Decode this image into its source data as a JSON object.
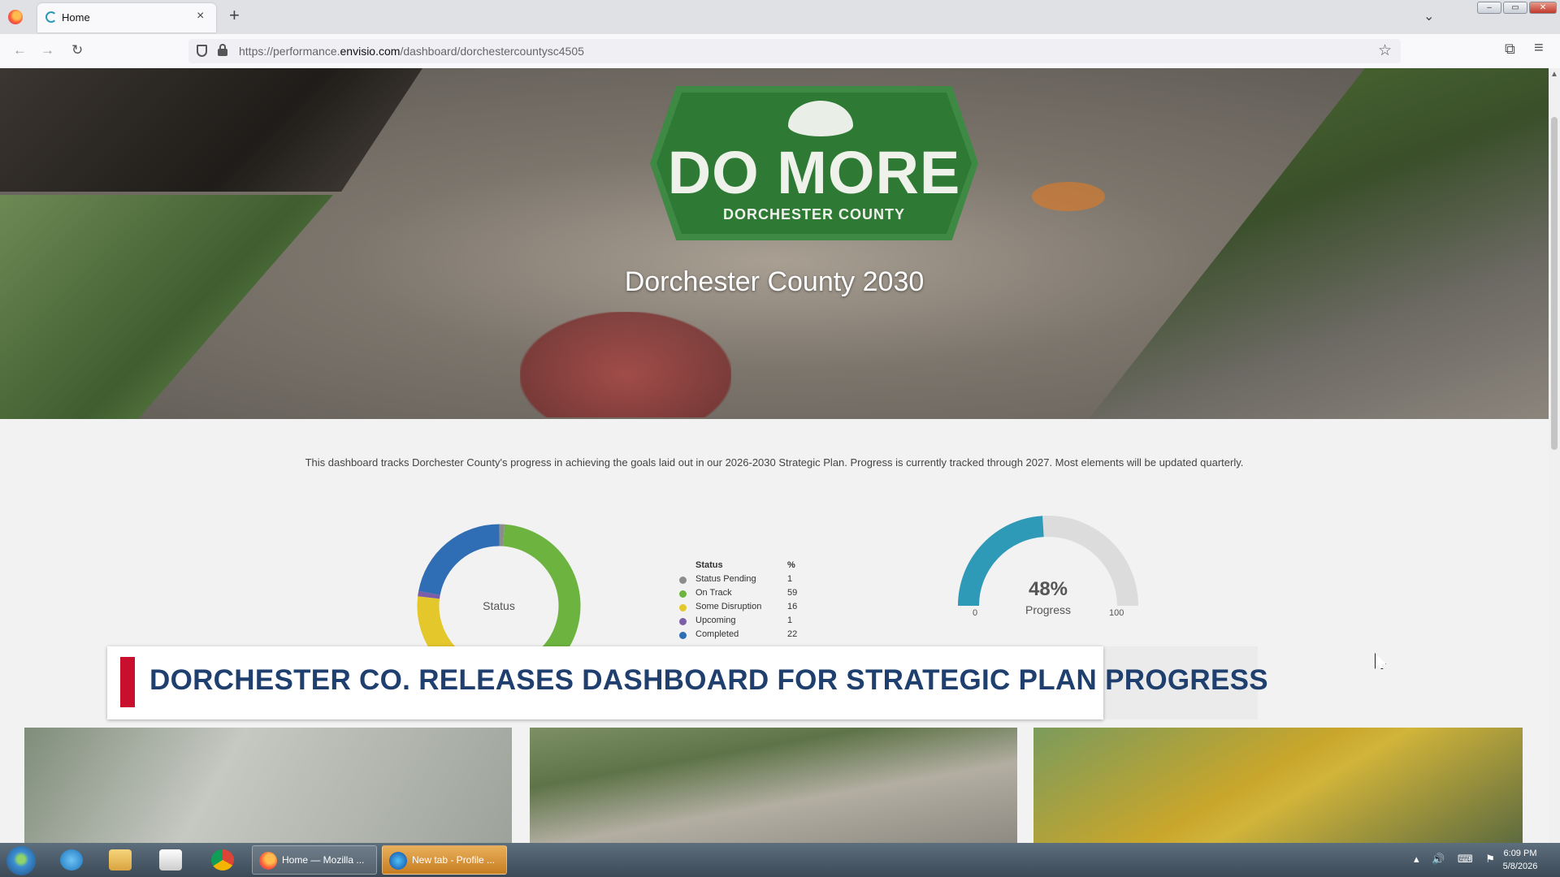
{
  "browser": {
    "tab_title": "Home",
    "tab_close": "×",
    "new_tab": "+",
    "tab_list": "⌄",
    "url_prefix": "https://performance.",
    "url_domain": "envisio.com",
    "url_path": "/dashboard/dorchestercountysc4505",
    "back": "←",
    "forward": "→",
    "reload": "↻",
    "star": "☆",
    "extensions": "⧉",
    "menu": "≡",
    "win_min": "–",
    "win_max": "▭",
    "win_close": "✕"
  },
  "hero": {
    "logo_main": "DO MORE",
    "logo_sub": "DORCHESTER COUNTY",
    "title": "Dorchester County 2030"
  },
  "intro": "This dashboard tracks Dorchester County's progress in achieving the goals laid out in our 2026-2030 Strategic Plan. Progress is currently tracked through 2027. Most elements will be updated quarterly.",
  "chart_data": [
    {
      "type": "pie",
      "title": "Status",
      "legend_header": [
        "Status",
        "%"
      ],
      "categories": [
        "Status Pending",
        "On Track",
        "Some Disruption",
        "Upcoming",
        "Completed"
      ],
      "values": [
        1,
        59,
        16,
        1,
        22
      ],
      "colors": [
        "#8c8c8c",
        "#6cb33f",
        "#e3c72b",
        "#7b5ea7",
        "#2f6db5"
      ],
      "legend_placement": "right"
    },
    {
      "type": "gauge",
      "value": 48,
      "value_label": "48%",
      "label": "Progress",
      "min": 0,
      "max": 100,
      "min_label": "0",
      "max_label": "100",
      "fill_color": "#2e9ab8",
      "track_color": "#dcdcdc"
    }
  ],
  "news": {
    "headline": "DORCHESTER CO. RELEASES DASHBOARD FOR STRATEGIC PLAN PROGRESS"
  },
  "taskbar": {
    "task1": "Home — Mozilla ...",
    "task2": "New tab - Profile ...",
    "tray": "▴ 🔊 ⌨ ⚑",
    "time": "6:09 PM",
    "date": "5/8/2026"
  }
}
